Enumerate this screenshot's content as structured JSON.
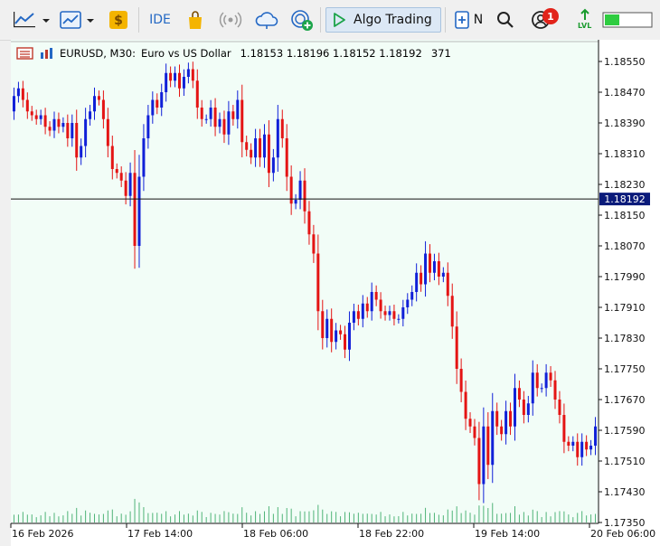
{
  "toolbar": {
    "icons": [
      "line-chart-icon",
      "chart-templates-icon",
      "dollar-coin-icon",
      "ide-icon",
      "market-bag-icon",
      "signal-icon",
      "cloud-icon",
      "vps-icon",
      "play-icon",
      "new-order-icon",
      "search-icon",
      "user-account-icon",
      "level-icon",
      "battery-level-icon"
    ],
    "ide_label": "IDE",
    "algo_trading_label": "Algo Trading",
    "new_order_label": "N",
    "notification_count": "1",
    "lvl_label": "LVL",
    "signal_level": 0.32,
    "colors": {
      "coin": "#f4b400",
      "algo_bg": "#dce8f5",
      "play": "#1ca44a",
      "badge": "#e2231a",
      "signal": "#2ecc40"
    }
  },
  "chart": {
    "header": {
      "symbol": "EURUSD, M30:",
      "description": "Euro vs US Dollar",
      "ohlc": "1.18153 1.18196 1.18152 1.18192",
      "volume": "371"
    },
    "colors": {
      "background": "#f2fdf7",
      "bull": "#1020d8",
      "bear": "#e41414",
      "volume": "#50b478",
      "grid": "#111111",
      "price_label_bg": "#0a1a7a"
    },
    "current_price": "1.18192",
    "current_price_value": 1.18192,
    "y_ticks": [
      "1.18550",
      "1.18470",
      "1.18390",
      "1.18310",
      "1.18230",
      "1.18150",
      "1.18070",
      "1.17990",
      "1.17910",
      "1.17830",
      "1.17750",
      "1.17670",
      "1.17590",
      "1.17510",
      "1.17430",
      "1.17350"
    ],
    "x_ticks": [
      "16 Feb 2026",
      "17 Feb 14:00",
      "18 Feb 06:00",
      "18 Feb 22:00",
      "19 Feb 14:00",
      "20 Feb 06:00"
    ]
  },
  "chart_data": {
    "type": "candlestick",
    "symbol": "EURUSD",
    "timeframe": "M30",
    "y_range": [
      1.1731,
      1.1858
    ],
    "closes": [
      1.1846,
      1.1848,
      1.1845,
      1.1842,
      1.1841,
      1.184,
      1.1841,
      1.1838,
      1.1837,
      1.184,
      1.1838,
      1.1839,
      1.1835,
      1.1839,
      1.183,
      1.1833,
      1.184,
      1.1842,
      1.1846,
      1.1845,
      1.184,
      1.1833,
      1.1827,
      1.1826,
      1.1824,
      1.182,
      1.1826,
      1.1807,
      1.1825,
      1.1835,
      1.1841,
      1.1845,
      1.1843,
      1.1847,
      1.1852,
      1.185,
      1.1852,
      1.1848,
      1.1851,
      1.1853,
      1.185,
      1.1843,
      1.184,
      1.184,
      1.1843,
      1.1838,
      1.184,
      1.1836,
      1.1842,
      1.184,
      1.1845,
      1.1834,
      1.1832,
      1.183,
      1.1835,
      1.183,
      1.1836,
      1.1826,
      1.183,
      1.184,
      1.1835,
      1.1825,
      1.1818,
      1.1819,
      1.1824,
      1.1816,
      1.181,
      1.1805,
      1.179,
      1.1783,
      1.1788,
      1.1782,
      1.1785,
      1.1784,
      1.178,
      1.1787,
      1.179,
      1.1788,
      1.1792,
      1.179,
      1.1795,
      1.1793,
      1.179,
      1.1789,
      1.179,
      1.1788,
      1.1788,
      1.1791,
      1.1793,
      1.1795,
      1.18,
      1.1797,
      1.1805,
      1.18,
      1.1803,
      1.1799,
      1.18,
      1.1794,
      1.1786,
      1.1775,
      1.1769,
      1.1762,
      1.176,
      1.1757,
      1.1745,
      1.176,
      1.175,
      1.1764,
      1.176,
      1.1758,
      1.1764,
      1.176,
      1.177,
      1.1767,
      1.1763,
      1.1766,
      1.1774,
      1.177,
      1.177,
      1.1774,
      1.1772,
      1.1767,
      1.1763,
      1.1756,
      1.1755,
      1.1756,
      1.1752,
      1.1756,
      1.1754,
      1.1755,
      1.176
    ],
    "x_labels": [
      "16 Feb 2026",
      "17 Feb 14:00",
      "18 Feb 06:00",
      "18 Feb 22:00",
      "19 Feb 14:00",
      "20 Feb 06:00"
    ]
  }
}
